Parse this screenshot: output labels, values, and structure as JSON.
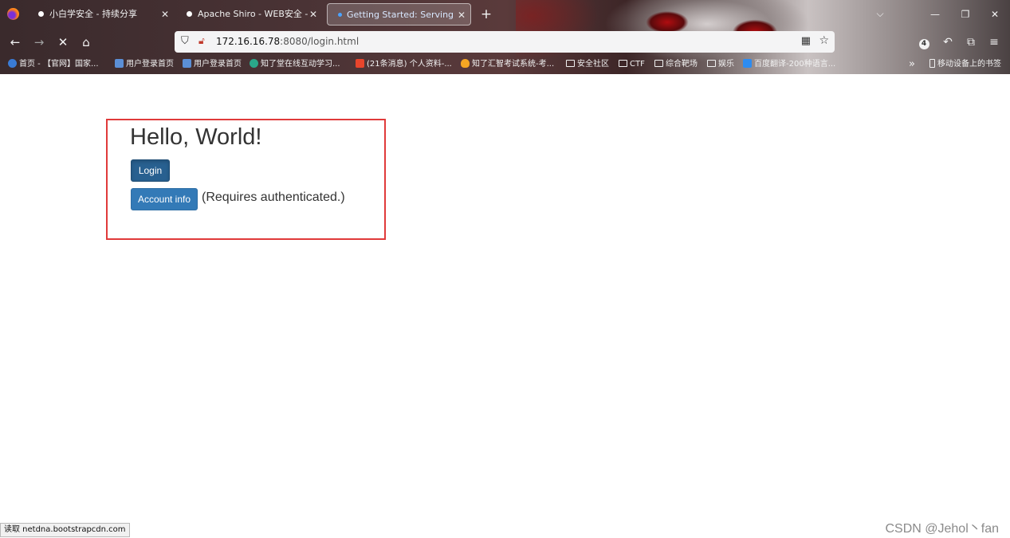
{
  "browser": {
    "tabs": [
      {
        "label": "小白学安全 - 持续分享",
        "active": false
      },
      {
        "label": "Apache Shiro - WEB安全 - 小白",
        "active": false
      },
      {
        "label": "Getting Started: Serving Web",
        "active": true
      }
    ],
    "url": {
      "host": "172.16.16.78",
      "rest": ":8080/login.html"
    },
    "extension_badge": "4",
    "bookmarks": [
      {
        "label": "首页 - 【官网】国家...",
        "icon": "globe-icon"
      },
      {
        "label": "用户登录首页",
        "icon": "page-icon"
      },
      {
        "label": "用户登录首页",
        "icon": "page-icon"
      },
      {
        "label": "知了堂在线互动学习...",
        "icon": "site-icon"
      },
      {
        "label": "(21条消息) 个人资料-...",
        "icon": "csdn-icon"
      },
      {
        "label": "知了汇智考试系统-考...",
        "icon": "flame-icon"
      },
      {
        "label": "安全社区",
        "icon": "folder-icon"
      },
      {
        "label": "CTF",
        "icon": "folder-icon"
      },
      {
        "label": "综合靶场",
        "icon": "folder-icon"
      },
      {
        "label": "娱乐",
        "icon": "folder-icon"
      },
      {
        "label": "百度翻译-200种语言...",
        "icon": "translate-icon"
      }
    ],
    "mobile_bookmarks": "移动设备上的书签",
    "status_text": "读取 netdna.bootstrapcdn.com",
    "colors": {
      "accent": "#337ab7",
      "box_border": "#e03a3a"
    }
  },
  "page": {
    "heading": "Hello, World!",
    "login_button": "Login",
    "account_button": "Account info",
    "requires_text": "(Requires authenticated.)"
  },
  "watermark": "CSDN @Jehol丶fan"
}
